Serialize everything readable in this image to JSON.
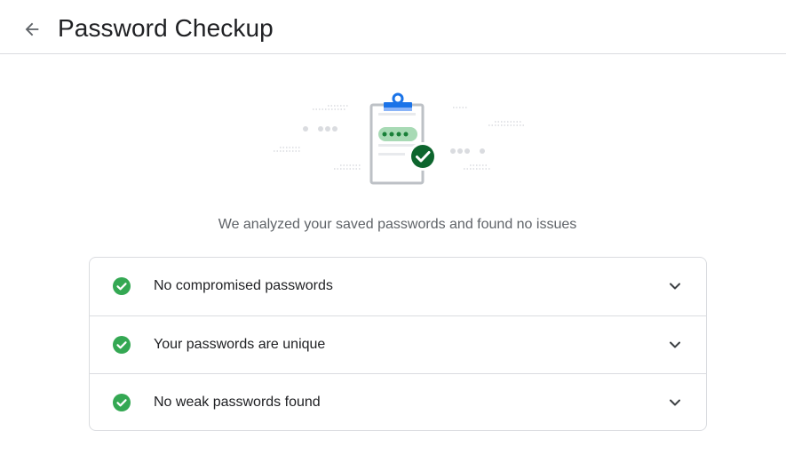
{
  "header": {
    "title": "Password Checkup",
    "back_icon": "arrow-back-icon"
  },
  "illustration": {
    "icon": "clipboard-password-check-icon"
  },
  "summary": {
    "text": "We analyzed your saved passwords and found no issues"
  },
  "results": {
    "items": [
      {
        "label": "No compromised passwords",
        "status_icon": "check-circle-icon",
        "expand_icon": "chevron-down-icon"
      },
      {
        "label": "Your passwords are unique",
        "status_icon": "check-circle-icon",
        "expand_icon": "chevron-down-icon"
      },
      {
        "label": "No weak passwords found",
        "status_icon": "check-circle-icon",
        "expand_icon": "chevron-down-icon"
      }
    ]
  },
  "colors": {
    "success_green": "#34a853",
    "dark_green": "#188038",
    "accent_blue": "#1a73e8",
    "text_primary": "#202124",
    "text_secondary": "#5f6368",
    "divider": "#dadce0"
  }
}
